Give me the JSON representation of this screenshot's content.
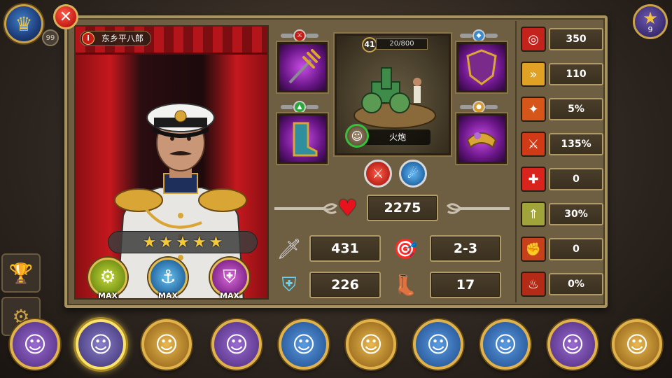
{
  "top": {
    "level_badge": "99",
    "stars_count": "9"
  },
  "general": {
    "name": "东乡平八郎",
    "stars": [
      "★",
      "★",
      "★",
      "★",
      "★"
    ],
    "skills": [
      {
        "icon": "wheel-cannon-icon",
        "label": "MAX"
      },
      {
        "icon": "anchor-icon",
        "label": "MAX"
      },
      {
        "icon": "shield-icon",
        "label": "MAX"
      }
    ]
  },
  "unit": {
    "level": "41",
    "xp": "20/800",
    "name": "火炮"
  },
  "stats": {
    "hp": "2275",
    "attack": "431",
    "range": "2-3",
    "defense": "226",
    "speed": "17"
  },
  "right_stats": [
    {
      "icon": "target-icon",
      "value": "350",
      "color": "#c4231b"
    },
    {
      "icon": "speed-boots-icon",
      "value": "110",
      "color": "#e0a125"
    },
    {
      "icon": "crit-icon",
      "value": "5%",
      "color": "#d6561a"
    },
    {
      "icon": "crit-damage-icon",
      "value": "135%",
      "color": "#d03a16"
    },
    {
      "icon": "heal-icon",
      "value": "0",
      "color": "#d8241c"
    },
    {
      "icon": "rank-up-icon",
      "value": "30%",
      "color": "#a0a43a"
    },
    {
      "icon": "fist-icon",
      "value": "0",
      "color": "#c6401c"
    },
    {
      "icon": "fire-figure-icon",
      "value": "0%",
      "color": "#b32a16"
    }
  ],
  "heroes": [
    {
      "id": "hero-1",
      "bg": "#7a4ab0"
    },
    {
      "id": "hero-2",
      "bg": "#6a5fa8",
      "selected": true
    },
    {
      "id": "hero-3",
      "bg": "#c89530"
    },
    {
      "id": "hero-4",
      "bg": "#7a4ab0"
    },
    {
      "id": "hero-5",
      "bg": "#3a78c0"
    },
    {
      "id": "hero-6",
      "bg": "#c89530"
    },
    {
      "id": "hero-7",
      "bg": "#3a78c0"
    },
    {
      "id": "hero-8",
      "bg": "#3a78c0"
    },
    {
      "id": "hero-9",
      "bg": "#7a4ab0"
    },
    {
      "id": "hero-10",
      "bg": "#c89530"
    }
  ]
}
